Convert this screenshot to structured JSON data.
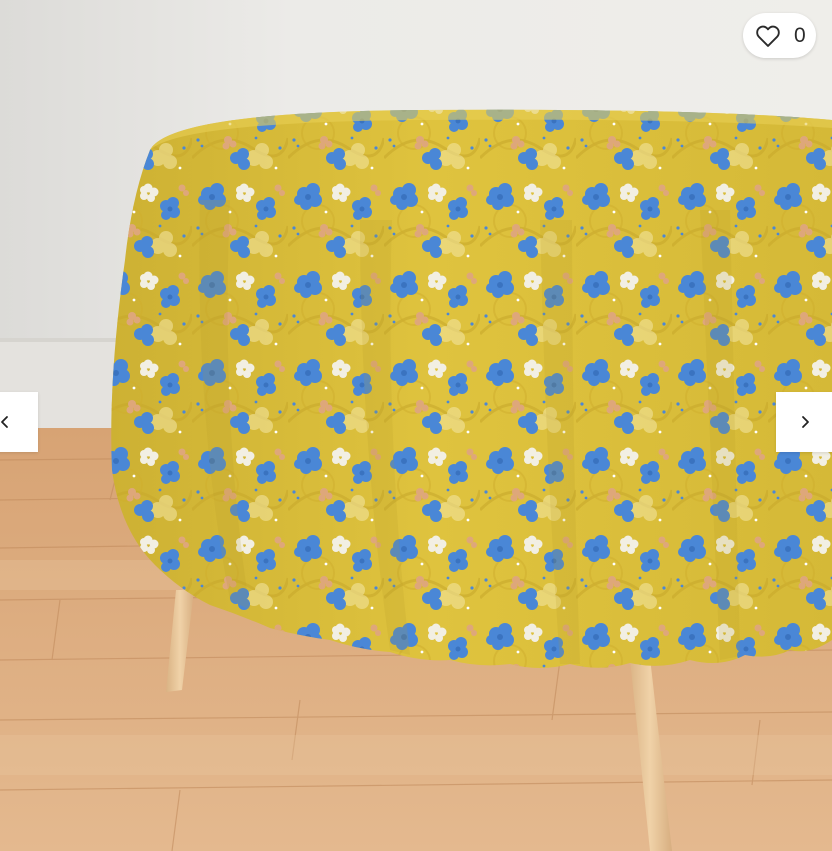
{
  "product_image": {
    "alt": "",
    "colors": {
      "wall": "#ecebe8",
      "baseboard": "#dedcd8",
      "floor": "#cf9a6c",
      "cloth": "#dcc03a",
      "flower_blue": "#4a87d6",
      "flower_peach": "#d9a872",
      "flower_white": "#f1ecd9",
      "table_leg": "#e7c497"
    }
  },
  "favorite": {
    "count": "0",
    "icon": "heart-outline-icon"
  },
  "gallery": {
    "prev_icon": "chevron-left-icon",
    "next_icon": "chevron-right-icon"
  }
}
